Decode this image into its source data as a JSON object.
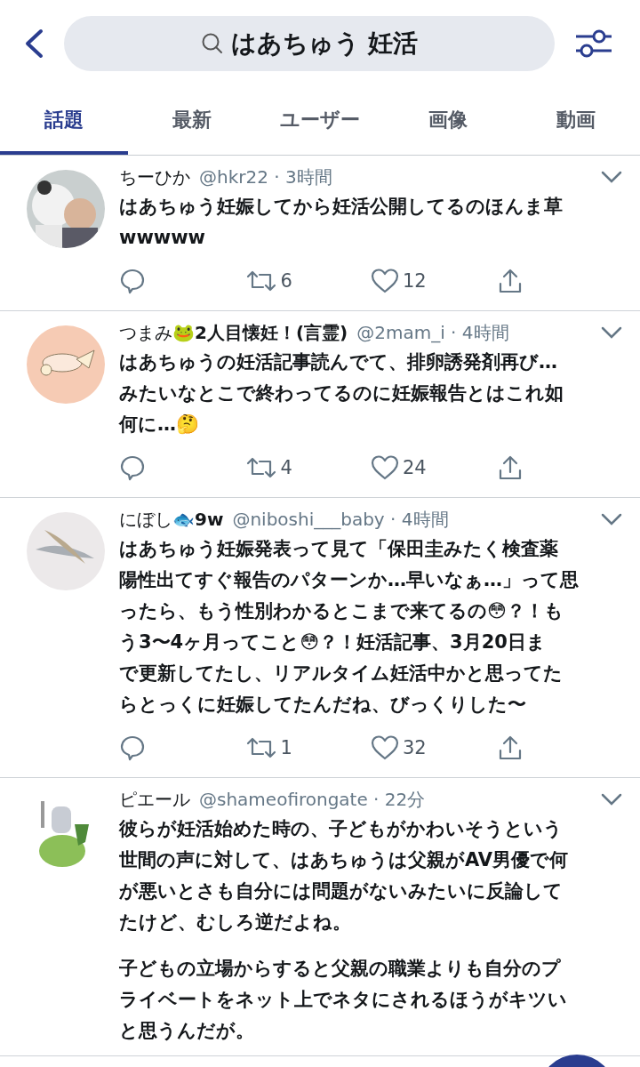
{
  "search": {
    "query": "はあちゅう 妊活"
  },
  "tabs": [
    {
      "label": "話題",
      "selected": true
    },
    {
      "label": "最新",
      "selected": false
    },
    {
      "label": "ユーザー",
      "selected": false
    },
    {
      "label": "画像",
      "selected": false
    },
    {
      "label": "動画",
      "selected": false
    }
  ],
  "tweets": [
    {
      "name": "ちーひか",
      "handle_time": "@hkr22 · 3時間",
      "paragraphs": [
        [
          "はあちゅう妊娠してから妊活公開してるのほんま草",
          "wwwww"
        ]
      ],
      "retweets": "6",
      "likes": "12"
    },
    {
      "name": "つまみ🐸**2人目懐妊！(言霊)**",
      "handle_time": "@2mam_i · 4時間",
      "paragraphs": [
        [
          "はあちゅうの妊活記事読んでて、排卵誘発剤再び…",
          "みたいなとこで終わってるのに妊娠報告とはこれ如",
          "何に…🤔"
        ]
      ],
      "retweets": "4",
      "likes": "24"
    },
    {
      "name": "にぼし🐟**9w**",
      "handle_time": "@niboshi___baby · 4時間",
      "paragraphs": [
        [
          "はあちゅう妊娠発表って見て「保田圭みたく検査薬",
          "陽性出てすぐ報告のパターンか…早いなぁ…」って思",
          "ったら、もう性別わかるとこまで来てるの😳？！も",
          "う3〜4ヶ月ってこと😳？！妊活記事、3月20日ま",
          "で更新してたし、リアルタイム妊活中かと思ってた",
          "らとっくに妊娠してたんだね、びっくりした〜"
        ]
      ],
      "retweets": "1",
      "likes": "32"
    },
    {
      "name": "ピエール",
      "handle_time": "@shameofirongate · 22分",
      "paragraphs": [
        [
          "彼らが妊活始めた時の、子どもがかわいそうという",
          "世間の声に対して、はあちゅうは父親がAV男優で何",
          "が悪いとさも自分には問題がないみたいに反論して",
          "たけど、むしろ逆だよね。"
        ],
        [
          "子どもの立場からすると父親の職業よりも自分のプ",
          "ライベートをネット上でネタにされるほうがキツい",
          "と思うんだが。"
        ]
      ]
    }
  ]
}
